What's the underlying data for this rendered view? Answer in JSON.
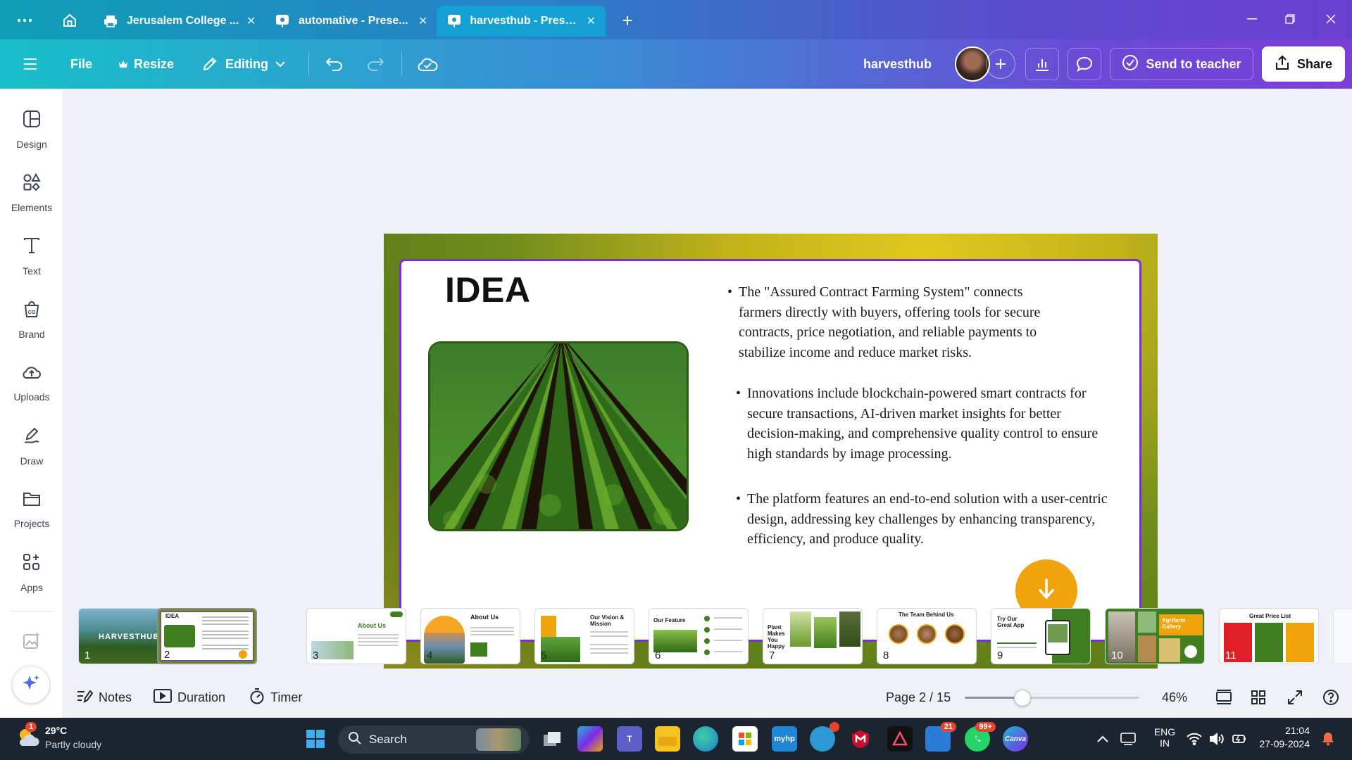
{
  "browser": {
    "tabs": [
      {
        "title": "Jerusalem College ...",
        "icon": "printer-icon",
        "active": false
      },
      {
        "title": "automative - Prese...",
        "icon": "canva-present-icon",
        "active": false
      },
      {
        "title": "harvesthub - Prese...",
        "icon": "canva-present-icon",
        "active": true
      }
    ],
    "close_glyph": "✕",
    "new_tab_glyph": "+"
  },
  "header": {
    "file_label": "File",
    "resize_label": "Resize",
    "editing_label": "Editing",
    "doc_title": "harvesthub",
    "send_label": "Send to teacher",
    "share_label": "Share"
  },
  "sidebar": {
    "items": [
      {
        "label": "Design",
        "icon": "design-icon"
      },
      {
        "label": "Elements",
        "icon": "elements-icon"
      },
      {
        "label": "Text",
        "icon": "text-icon"
      },
      {
        "label": "Brand",
        "icon": "brand-icon"
      },
      {
        "label": "Uploads",
        "icon": "uploads-icon"
      },
      {
        "label": "Draw",
        "icon": "draw-icon"
      },
      {
        "label": "Projects",
        "icon": "projects-icon"
      },
      {
        "label": "Apps",
        "icon": "apps-icon"
      }
    ]
  },
  "slide": {
    "title": "IDEA",
    "bullets": [
      "The \"Assured Contract Farming System\" connects farmers directly with buyers, offering tools for secure contracts, price negotiation, and reliable payments to stabilize income and reduce market risks.",
      "Innovations include blockchain-powered smart contracts for secure transactions, AI-driven market insights for better decision-making, and comprehensive quality control to ensure high standards by image processing.",
      "The platform features an end-to-end solution with a user-centric design, addressing key challenges by enhancing transparency, efficiency, and produce quality."
    ],
    "bullet_glyph": "•",
    "colors": {
      "border": "#7d2ae8",
      "arrow_button": "#f0a30a"
    }
  },
  "thumbnails": [
    {
      "n": "1",
      "title": "HARVESTHUB"
    },
    {
      "n": "2",
      "title": "IDEA"
    },
    {
      "n": "3",
      "title": "About Us"
    },
    {
      "n": "4",
      "title": "About Us"
    },
    {
      "n": "5",
      "title": "Our Vision & Mission"
    },
    {
      "n": "6",
      "title": "Our Feature"
    },
    {
      "n": "7",
      "title": "Plant Makes You Happy"
    },
    {
      "n": "8",
      "title": "The Team Behind Us"
    },
    {
      "n": "9",
      "title": "Try Our Great App"
    },
    {
      "n": "10",
      "title": "Agrifarm Gallery"
    },
    {
      "n": "11",
      "title": "Great Price List"
    }
  ],
  "footer": {
    "notes_label": "Notes",
    "duration_label": "Duration",
    "timer_label": "Timer",
    "page_indicator": "Page 2 / 15",
    "zoom_label": "46%",
    "zoom_fraction": 0.46
  },
  "taskbar": {
    "weather_temp": "29°C",
    "weather_desc": "Partly cloudy",
    "weather_badge": "1",
    "search_label": "Search",
    "badges": {
      "teams": "21",
      "whatsapp": "99+"
    },
    "lang_top": "ENG",
    "lang_bottom": "IN",
    "time": "21:04",
    "date": "27-09-2024",
    "myhp_label": "myhp",
    "canva_label": "Canva"
  }
}
